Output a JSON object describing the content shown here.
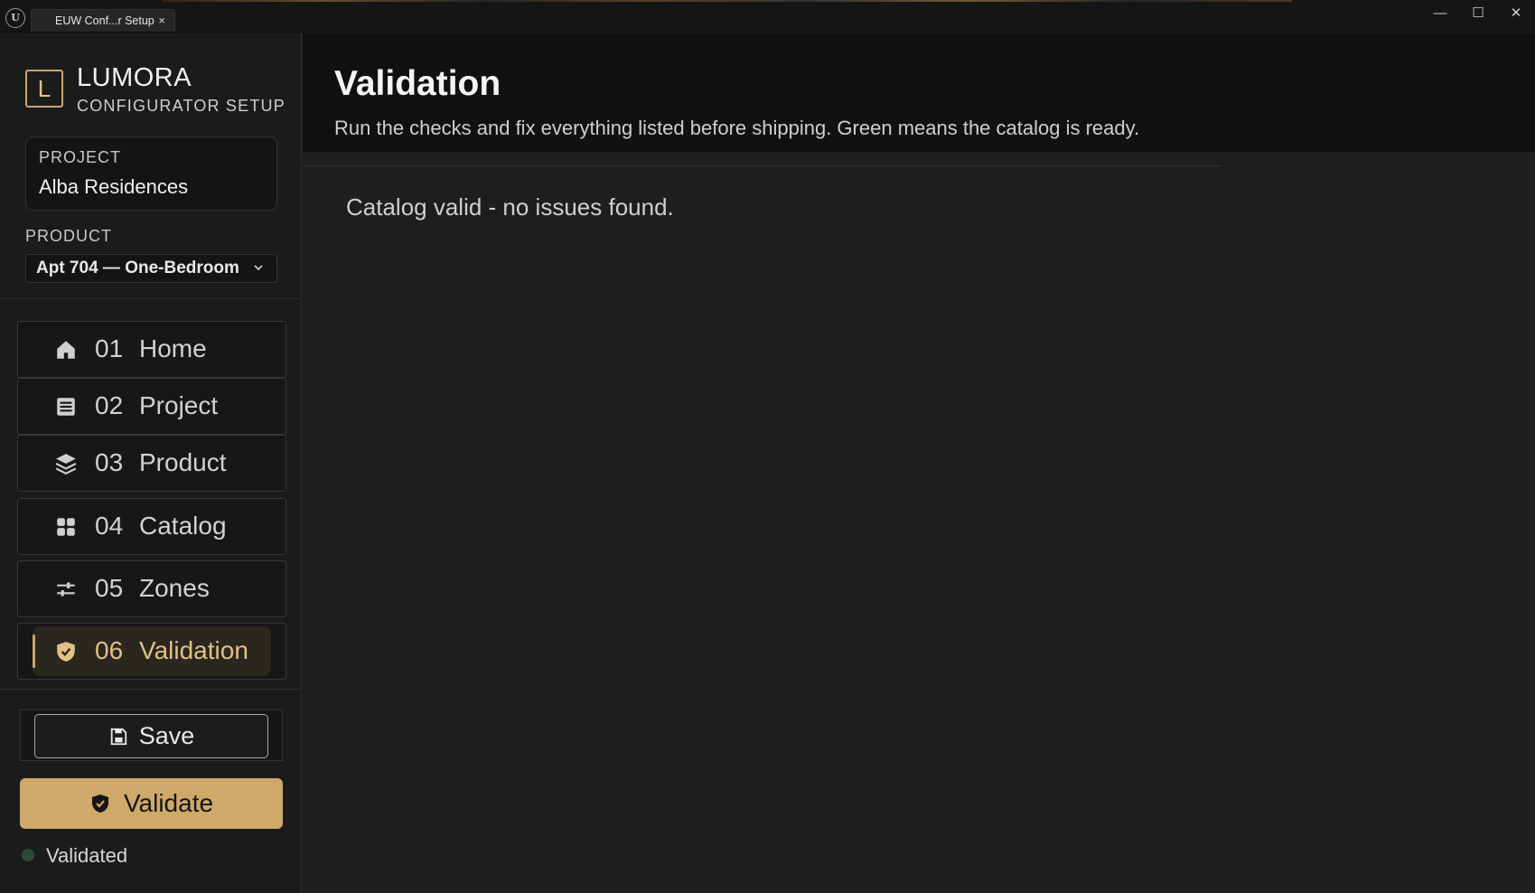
{
  "window": {
    "tab_title": "EUW Conf...r Setup",
    "tab_close": "×",
    "controls": {
      "minimize": "—",
      "maximize": "☐",
      "close": "✕"
    }
  },
  "brand": {
    "mark": "L",
    "name": "LUMORA",
    "subtitle": "CONFIGURATOR SETUP"
  },
  "project": {
    "label": "PROJECT",
    "value": "Alba Residences"
  },
  "product": {
    "label": "PRODUCT",
    "selected": "Apt 704 — One-Bedroom"
  },
  "nav": {
    "items": [
      {
        "num": "01",
        "label": "Home",
        "icon": "home-icon"
      },
      {
        "num": "02",
        "label": "Project",
        "icon": "list-icon"
      },
      {
        "num": "03",
        "label": "Product",
        "icon": "layers-icon"
      },
      {
        "num": "04",
        "label": "Catalog",
        "icon": "grid-icon"
      },
      {
        "num": "05",
        "label": "Zones",
        "icon": "sliders-icon"
      },
      {
        "num": "06",
        "label": "Validation",
        "icon": "shield-check-icon",
        "active": true
      }
    ]
  },
  "actions": {
    "save_label": "Save",
    "validate_label": "Validate"
  },
  "status": {
    "text": "Validated"
  },
  "main": {
    "title": "Validation",
    "subtitle": "Run the checks and fix everything listed before shipping. Green means the catalog is ready.",
    "result": "Catalog valid - no issues found."
  },
  "colors": {
    "accent": "#cfa96a",
    "status_dot": "#2d4a36",
    "background": "#1e1e1e"
  }
}
